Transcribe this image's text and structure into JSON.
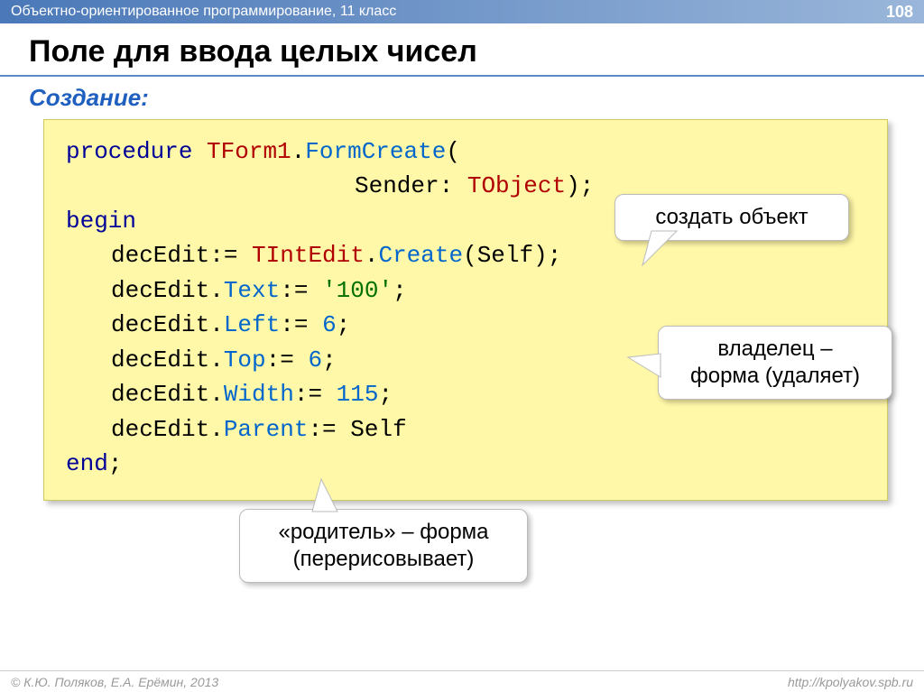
{
  "header": {
    "subject": "Объектно-ориентированное программирование, 11 класс",
    "page": "108"
  },
  "title": "Поле для ввода целых чисел",
  "subtitle": "Создание:",
  "code": {
    "kw_procedure": "procedure",
    "class1": "TForm1",
    "method_formcreate": "FormCreate",
    "param_sender": "Sender",
    "class2": "TObject",
    "kw_begin": "begin",
    "var": "decEdit",
    "class3": "TIntEdit",
    "method_create": "Create",
    "arg_self": "Self",
    "prop_text": "Text",
    "val_text": "'100'",
    "prop_left": "Left",
    "val_left": "6",
    "prop_top": "Top",
    "val_top": "6",
    "prop_width": "Width",
    "val_width": "115",
    "prop_parent": "Parent",
    "val_parent": "Self",
    "kw_end": "end"
  },
  "callouts": {
    "create_obj": "создать объект",
    "owner_line1": "владелец –",
    "owner_line2": "форма (удаляет)",
    "parent_line1": "«родитель» – форма",
    "parent_line2": "(перерисовывает)"
  },
  "footer": {
    "left": "© К.Ю. Поляков, Е.А. Ерёмин, 2013",
    "right": "http://kpolyakov.spb.ru"
  }
}
